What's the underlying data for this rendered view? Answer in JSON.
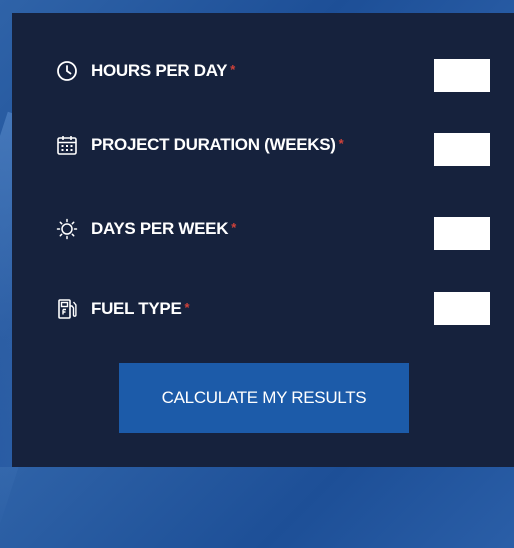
{
  "form": {
    "fields": [
      {
        "label": "HOURS PER DAY",
        "required_mark": "*",
        "icon": "clock-icon",
        "value": ""
      },
      {
        "label": "PROJECT DURATION (WEEKS)",
        "required_mark": "*",
        "icon": "calendar-icon",
        "value": ""
      },
      {
        "label": "DAYS PER WEEK",
        "required_mark": "*",
        "icon": "sun-icon",
        "value": ""
      },
      {
        "label": "FUEL TYPE",
        "required_mark": "*",
        "icon": "fuel-pump-icon",
        "value": ""
      }
    ],
    "submit_label": "CALCULATE MY RESULTS"
  },
  "colors": {
    "panel": "#16223d",
    "button": "#1c5ba9",
    "required": "#d0423a",
    "background": "#2a5ea7"
  }
}
